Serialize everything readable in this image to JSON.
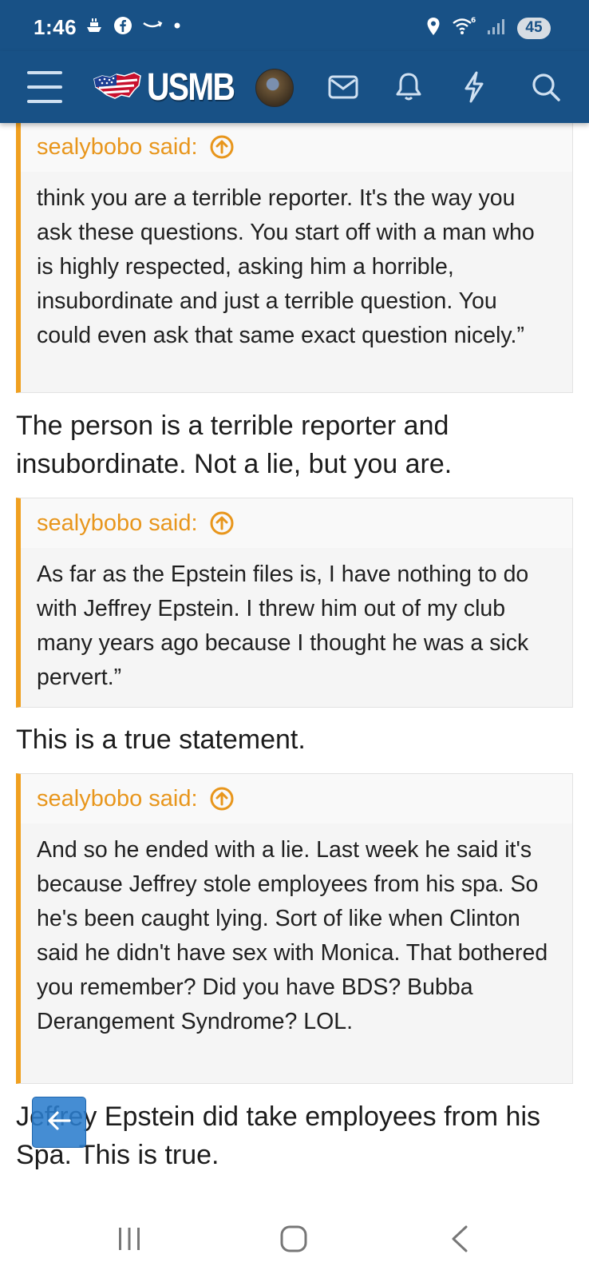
{
  "status_bar": {
    "time": "1:46",
    "battery": "45",
    "left_icons": [
      "steam-ship-icon",
      "facebook-icon",
      "amazon-smile-icon",
      "dot-icon"
    ],
    "right_icons": [
      "location-icon",
      "wifi-6-icon",
      "signal-icon",
      "battery-icon"
    ]
  },
  "header": {
    "logo_text": "USMB",
    "icons": [
      "menu-icon",
      "flag-logo-icon",
      "avatar",
      "mail-icon",
      "bell-icon",
      "lightning-icon",
      "search-icon"
    ]
  },
  "posts": [
    {
      "quote_author": "sealybobo said:",
      "quote_text": "think you are a terrible reporter. It's the way you ask these questions. You start off with a man who is highly respected, asking him a horrible, insubordinate and just a terrible question. You could even ask that same exact question nicely.”",
      "reply": "The person is a terrible reporter and insubordinate. Not a lie, but you are."
    },
    {
      "quote_author": "sealybobo said:",
      "quote_text": "As far as the Epstein files is, I have nothing to do with Jeffrey Epstein. I threw him out of my club many years ago because I thought he was a sick pervert.”",
      "reply": "This is a true statement."
    },
    {
      "quote_author": "sealybobo said:",
      "quote_text": "And so he ended with a lie. Last week he said it's because Jeffrey stole employees from his spa. So he's been caught lying. Sort of like when Clinton said he didn't have sex with Monica. That bothered you remember? Did you have BDS? Bubba Derangement Syndrome? LOL.",
      "reply": "Jeffrey Epstein did take employees from his Spa. This is true."
    }
  ],
  "colors": {
    "header_bg": "#185186",
    "quote_accent": "#f0a020",
    "quote_author": "#e8961c",
    "fab": "#2b7dcd"
  }
}
